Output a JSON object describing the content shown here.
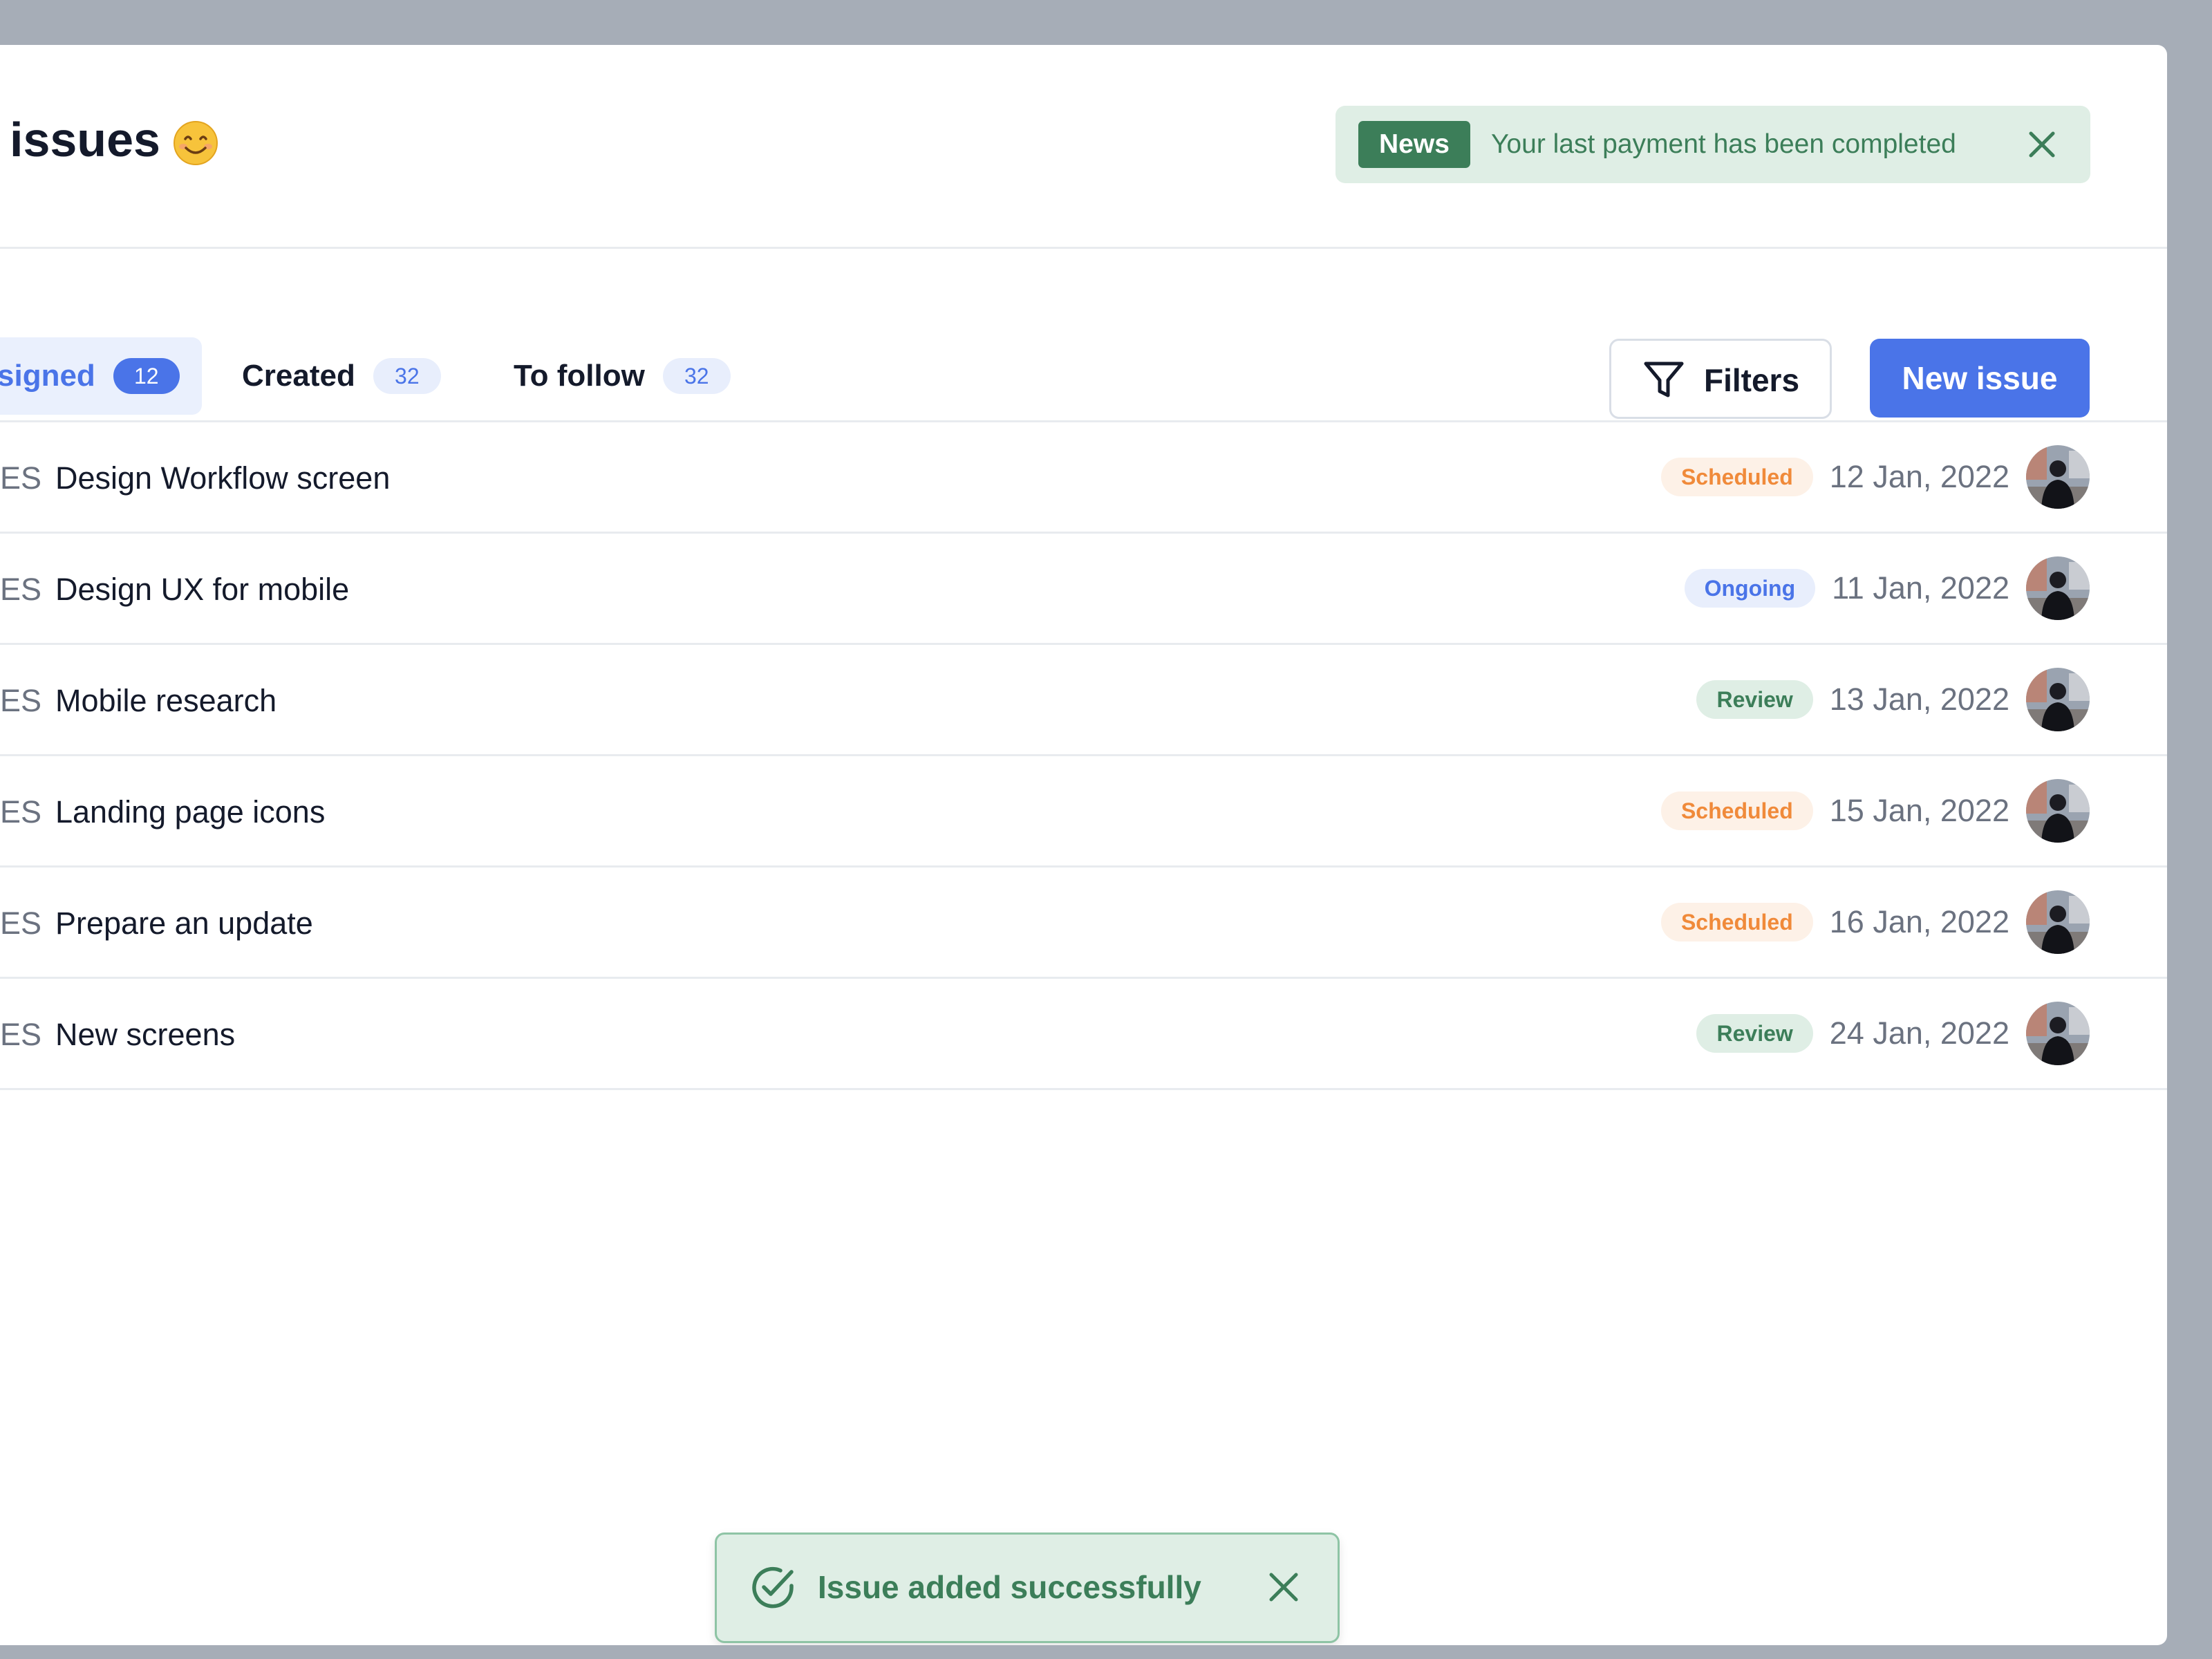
{
  "header": {
    "title": "issues",
    "emoji_icon": "smiling-face-emoji"
  },
  "news": {
    "badge": "News",
    "message": "Your last payment has been completed"
  },
  "tabs": [
    {
      "label": "signed",
      "count": "12",
      "active": true
    },
    {
      "label": "Created",
      "count": "32",
      "active": false
    },
    {
      "label": "To follow",
      "count": "32",
      "active": false
    }
  ],
  "toolbar": {
    "filters_label": "Filters",
    "filters_icon": "filter-funnel-icon",
    "new_issue_label": "New issue"
  },
  "issues": [
    {
      "prefix": "ES",
      "title": "Design Workflow screen",
      "status": "Scheduled",
      "date": "12 Jan, 2022"
    },
    {
      "prefix": "ES",
      "title": "Design UX for mobile",
      "status": "Ongoing",
      "date": "11 Jan, 2022"
    },
    {
      "prefix": "ES",
      "title": "Mobile research",
      "status": "Review",
      "date": "13 Jan, 2022"
    },
    {
      "prefix": "ES",
      "title": "Landing page icons",
      "status": "Scheduled",
      "date": "15 Jan, 2022"
    },
    {
      "prefix": "ES",
      "title": "Prepare an update",
      "status": "Scheduled",
      "date": "16 Jan, 2022"
    },
    {
      "prefix": "ES",
      "title": "New screens",
      "status": "Review",
      "date": "24 Jan, 2022"
    }
  ],
  "toast": {
    "message": "Issue added successfully",
    "icon": "check-circle-icon"
  },
  "colors": {
    "accent": "#4a74e8",
    "success": "#3c7e59",
    "warning": "#f08a3a",
    "backdrop": "#a6adb7"
  }
}
